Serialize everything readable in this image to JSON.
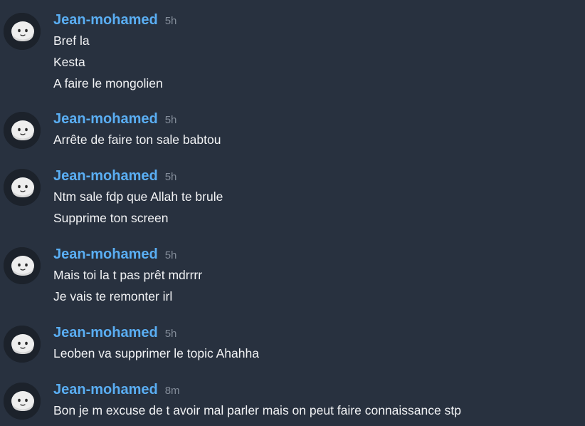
{
  "messages": [
    {
      "author": "Jean-mohamed",
      "time": "5h",
      "lines": [
        "Bref la",
        "Kesta",
        "A faire le mongolien"
      ]
    },
    {
      "author": "Jean-mohamed",
      "time": "5h",
      "lines": [
        "Arrête de faire ton sale babtou"
      ]
    },
    {
      "author": "Jean-mohamed",
      "time": "5h",
      "lines": [
        "Ntm sale fdp que Allah te brule",
        "Supprime ton screen"
      ]
    },
    {
      "author": "Jean-mohamed",
      "time": "5h",
      "lines": [
        "Mais toi la t pas prêt mdrrrr",
        "Je vais te remonter irl"
      ]
    },
    {
      "author": "Jean-mohamed",
      "time": "5h",
      "lines": [
        "Leoben va supprimer le topic Ahahha"
      ]
    },
    {
      "author": "Jean-mohamed",
      "time": "8m",
      "lines": [
        "Bon je m excuse de t avoir mal parler mais on peut faire connaissance stp"
      ]
    }
  ],
  "colors": {
    "background": "#28313f",
    "author": "#5aaef3",
    "timestamp": "#848d9a",
    "text": "#f2f3f5",
    "avatar_bg": "#1c222b"
  },
  "icons": {
    "avatar": "smiling-face-avatar-icon"
  }
}
